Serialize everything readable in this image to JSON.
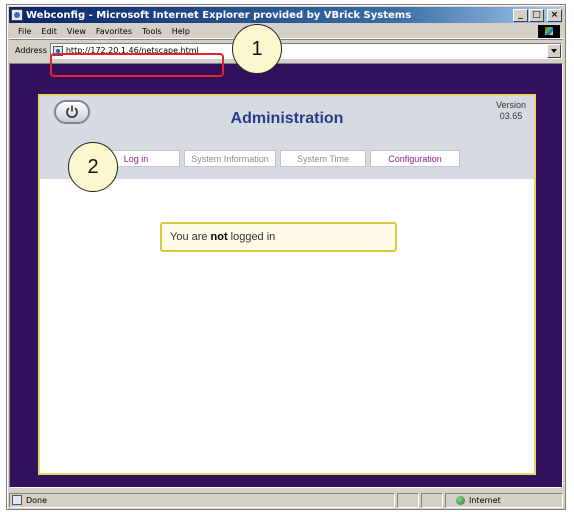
{
  "window": {
    "title": "Webconfig - Microsoft Internet Explorer provided by VBrick Systems",
    "controls": [
      "_",
      "□",
      "×"
    ]
  },
  "menu": [
    "File",
    "Edit",
    "View",
    "Favorites",
    "Tools",
    "Help"
  ],
  "address": {
    "label": "Address",
    "url": "http://172.20.1.46/netscape.html"
  },
  "page": {
    "title": "Administration",
    "version_label": "Version",
    "version_number": "03.65",
    "tabs": [
      {
        "label": "Log in",
        "style": "purple"
      },
      {
        "label": "System Information",
        "style": "gray"
      },
      {
        "label": "System Time",
        "style": "gray"
      },
      {
        "label": "Configuration",
        "style": "purple"
      }
    ],
    "status": {
      "prefix": "You are",
      "emphasis": "not",
      "suffix": "logged in"
    }
  },
  "statusbar": {
    "text": "Done",
    "zone": "Internet"
  },
  "callouts": [
    "1",
    "2"
  ],
  "colors": {
    "viewport_bg": "#33105c",
    "panel_border": "#e3d66a",
    "title": "#2b3a8c",
    "callout_border": "#e52330"
  }
}
